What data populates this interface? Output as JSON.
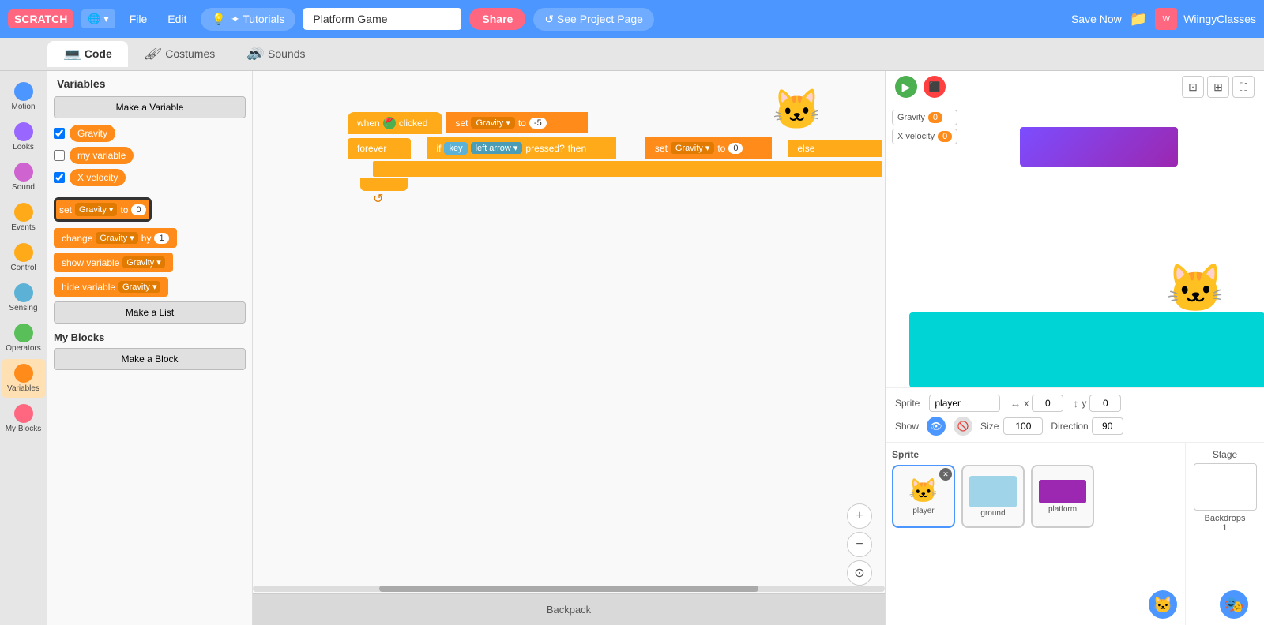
{
  "topbar": {
    "logo": "SCRATCH",
    "globe_label": "🌐",
    "file_label": "File",
    "edit_label": "Edit",
    "tutorials_label": "✦ Tutorials",
    "project_title": "Platform Game",
    "share_label": "Share",
    "see_project_label": "↺ See Project Page",
    "save_now_label": "Save Now",
    "user_label": "WiingyClasses"
  },
  "tabs": {
    "code_label": "💻 Code",
    "costumes_label": "🖌 Costumes",
    "sounds_label": "🔊 Sounds"
  },
  "categories": [
    {
      "id": "motion",
      "label": "Motion",
      "color": "#4c97ff"
    },
    {
      "id": "looks",
      "label": "Looks",
      "color": "#9966ff"
    },
    {
      "id": "sound",
      "label": "Sound",
      "color": "#cf63cf"
    },
    {
      "id": "events",
      "label": "Events",
      "color": "#ffab19"
    },
    {
      "id": "control",
      "label": "Control",
      "color": "#ffab19"
    },
    {
      "id": "sensing",
      "label": "Sensing",
      "color": "#5cb1d6"
    },
    {
      "id": "operators",
      "label": "Operators",
      "color": "#59c059"
    },
    {
      "id": "variables",
      "label": "Variables",
      "color": "#ff8c1a"
    },
    {
      "id": "myblocks",
      "label": "My Blocks",
      "color": "#ff6680"
    }
  ],
  "variables_panel": {
    "title": "Variables",
    "make_variable_label": "Make a Variable",
    "make_list_label": "Make a List",
    "make_block_label": "Make a Block",
    "vars": [
      {
        "name": "Gravity",
        "checked": true
      },
      {
        "name": "my variable",
        "checked": false
      },
      {
        "name": "X velocity",
        "checked": true
      }
    ],
    "blocks": {
      "set_label": "set",
      "gravity_dropdown": "Gravity",
      "to_label": "to",
      "set_value": "0",
      "change_label": "change",
      "change_var": "Gravity",
      "by_label": "by",
      "change_value": "1",
      "show_var_label": "show variable",
      "show_var_dropdown": "Gravity",
      "hide_var_label": "hide variable",
      "hide_var_dropdown": "Gravity"
    },
    "my_blocks_title": "My Blocks"
  },
  "script": {
    "event_label": "when",
    "flag_label": "🚩 clicked",
    "set1_var": "Gravity",
    "set1_to": "to",
    "set1_val": "-5",
    "forever_label": "forever",
    "if_label": "if",
    "key_label": "key",
    "arrow_dropdown": "left arrow",
    "pressed_label": "pressed?",
    "then_label": "then",
    "set2_var": "Gravity",
    "set2_val": "0",
    "else_label": "else",
    "end_cap": ""
  },
  "stage": {
    "green_flag_title": "Green Flag",
    "stop_title": "Stop",
    "var_display": [
      {
        "name": "Gravity",
        "value": "0"
      },
      {
        "name": "X velocity",
        "value": "0"
      }
    ]
  },
  "sprite_info": {
    "sprite_label": "Sprite",
    "sprite_name": "player",
    "x_label": "x",
    "x_value": "0",
    "y_label": "y",
    "y_value": "0",
    "show_label": "Show",
    "size_label": "Size",
    "size_value": "100",
    "direction_label": "Direction",
    "direction_value": "90"
  },
  "sprite_list": {
    "sprites_label": "Sprite",
    "stage_label": "Stage",
    "backdrops_label": "Backdrops",
    "backdrops_count": "1",
    "sprites": [
      {
        "name": "player",
        "active": true,
        "emoji": "🐱"
      },
      {
        "name": "ground",
        "type": "ground"
      },
      {
        "name": "platform",
        "type": "platform"
      }
    ]
  },
  "backpack": {
    "label": "Backpack"
  },
  "zoom": {
    "zoom_in_label": "+",
    "zoom_out_label": "−",
    "reset_label": "⊙"
  }
}
